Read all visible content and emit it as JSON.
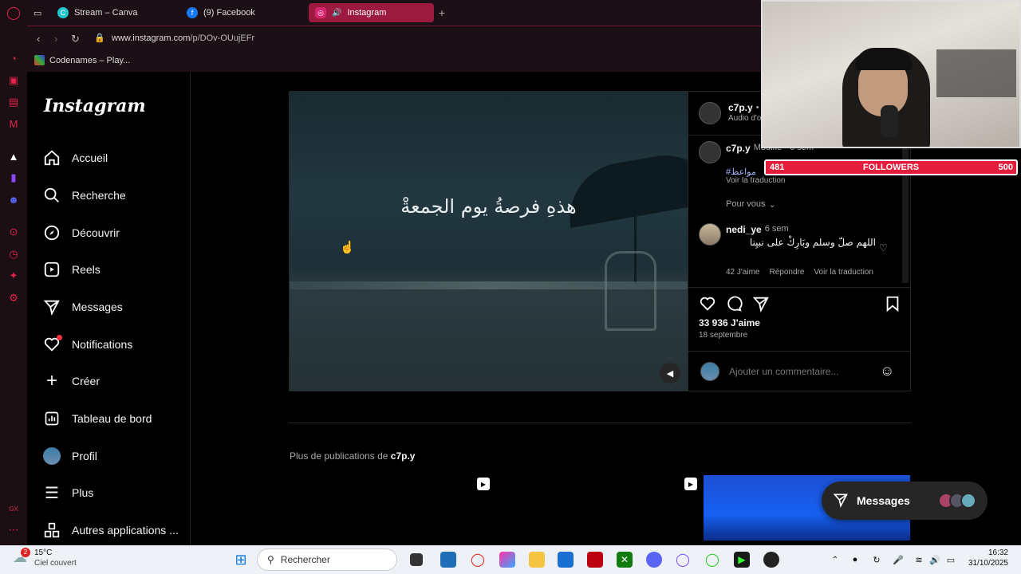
{
  "browser": {
    "tabs": [
      {
        "label": "Stream – Canva"
      },
      {
        "label": "(9) Facebook"
      },
      {
        "label": "Instagram"
      }
    ],
    "url_host": "www.instagram.com",
    "url_path": "/p/DOv-OUujEFr",
    "bookmark": "Codenames – Play..."
  },
  "ig_nav": {
    "logo": "Instagram",
    "items": [
      {
        "label": "Accueil"
      },
      {
        "label": "Recherche"
      },
      {
        "label": "Découvrir"
      },
      {
        "label": "Reels"
      },
      {
        "label": "Messages"
      },
      {
        "label": "Notifications"
      },
      {
        "label": "Créer"
      },
      {
        "label": "Tableau de bord"
      },
      {
        "label": "Profil"
      },
      {
        "label": "Plus"
      },
      {
        "label": "Autres applications ..."
      }
    ]
  },
  "post": {
    "video_caption": "هذهِ فرصةُ يوم الجمعةْ",
    "header_user": "c7p.y",
    "header_sep": "•",
    "header_audio": "Audio d'o",
    "caption_user": "c7p.y",
    "caption_meta": "Modifié • 6 sem",
    "caption_hashtag": "#مواعظ",
    "see_translation": "Voir la traduction",
    "for_you": "Pour vous",
    "comment": {
      "user": "nedi_ye",
      "time": "6 sem",
      "text": "اللهم صلّ وسلم وبَارِكْ على نبيِنا",
      "likes": "42 J'aime",
      "reply": "Répondre",
      "translate": "Voir la traduction"
    },
    "likes": "33 936 J'aime",
    "date": "18 septembre",
    "add_comment_placeholder": "Ajouter un commentaire..."
  },
  "stream_overlay": {
    "followers_current": "481",
    "followers_label": "FOLLOWERS",
    "followers_goal": "500",
    "followers_fraction": 0.962
  },
  "more": {
    "prefix": "Plus de publications de",
    "user": "c7p.y"
  },
  "messages_pill": {
    "label": "Messages"
  },
  "taskbar": {
    "weather_badge": "2",
    "temperature": "15°C",
    "weather": "Ciel couvert",
    "search": "Rechercher",
    "time": "16:32",
    "date": "31/10/2025"
  },
  "colors": {
    "accent": "#e31d3b",
    "tab_active": "#9c1a3f",
    "link": "#a9b4ff"
  }
}
